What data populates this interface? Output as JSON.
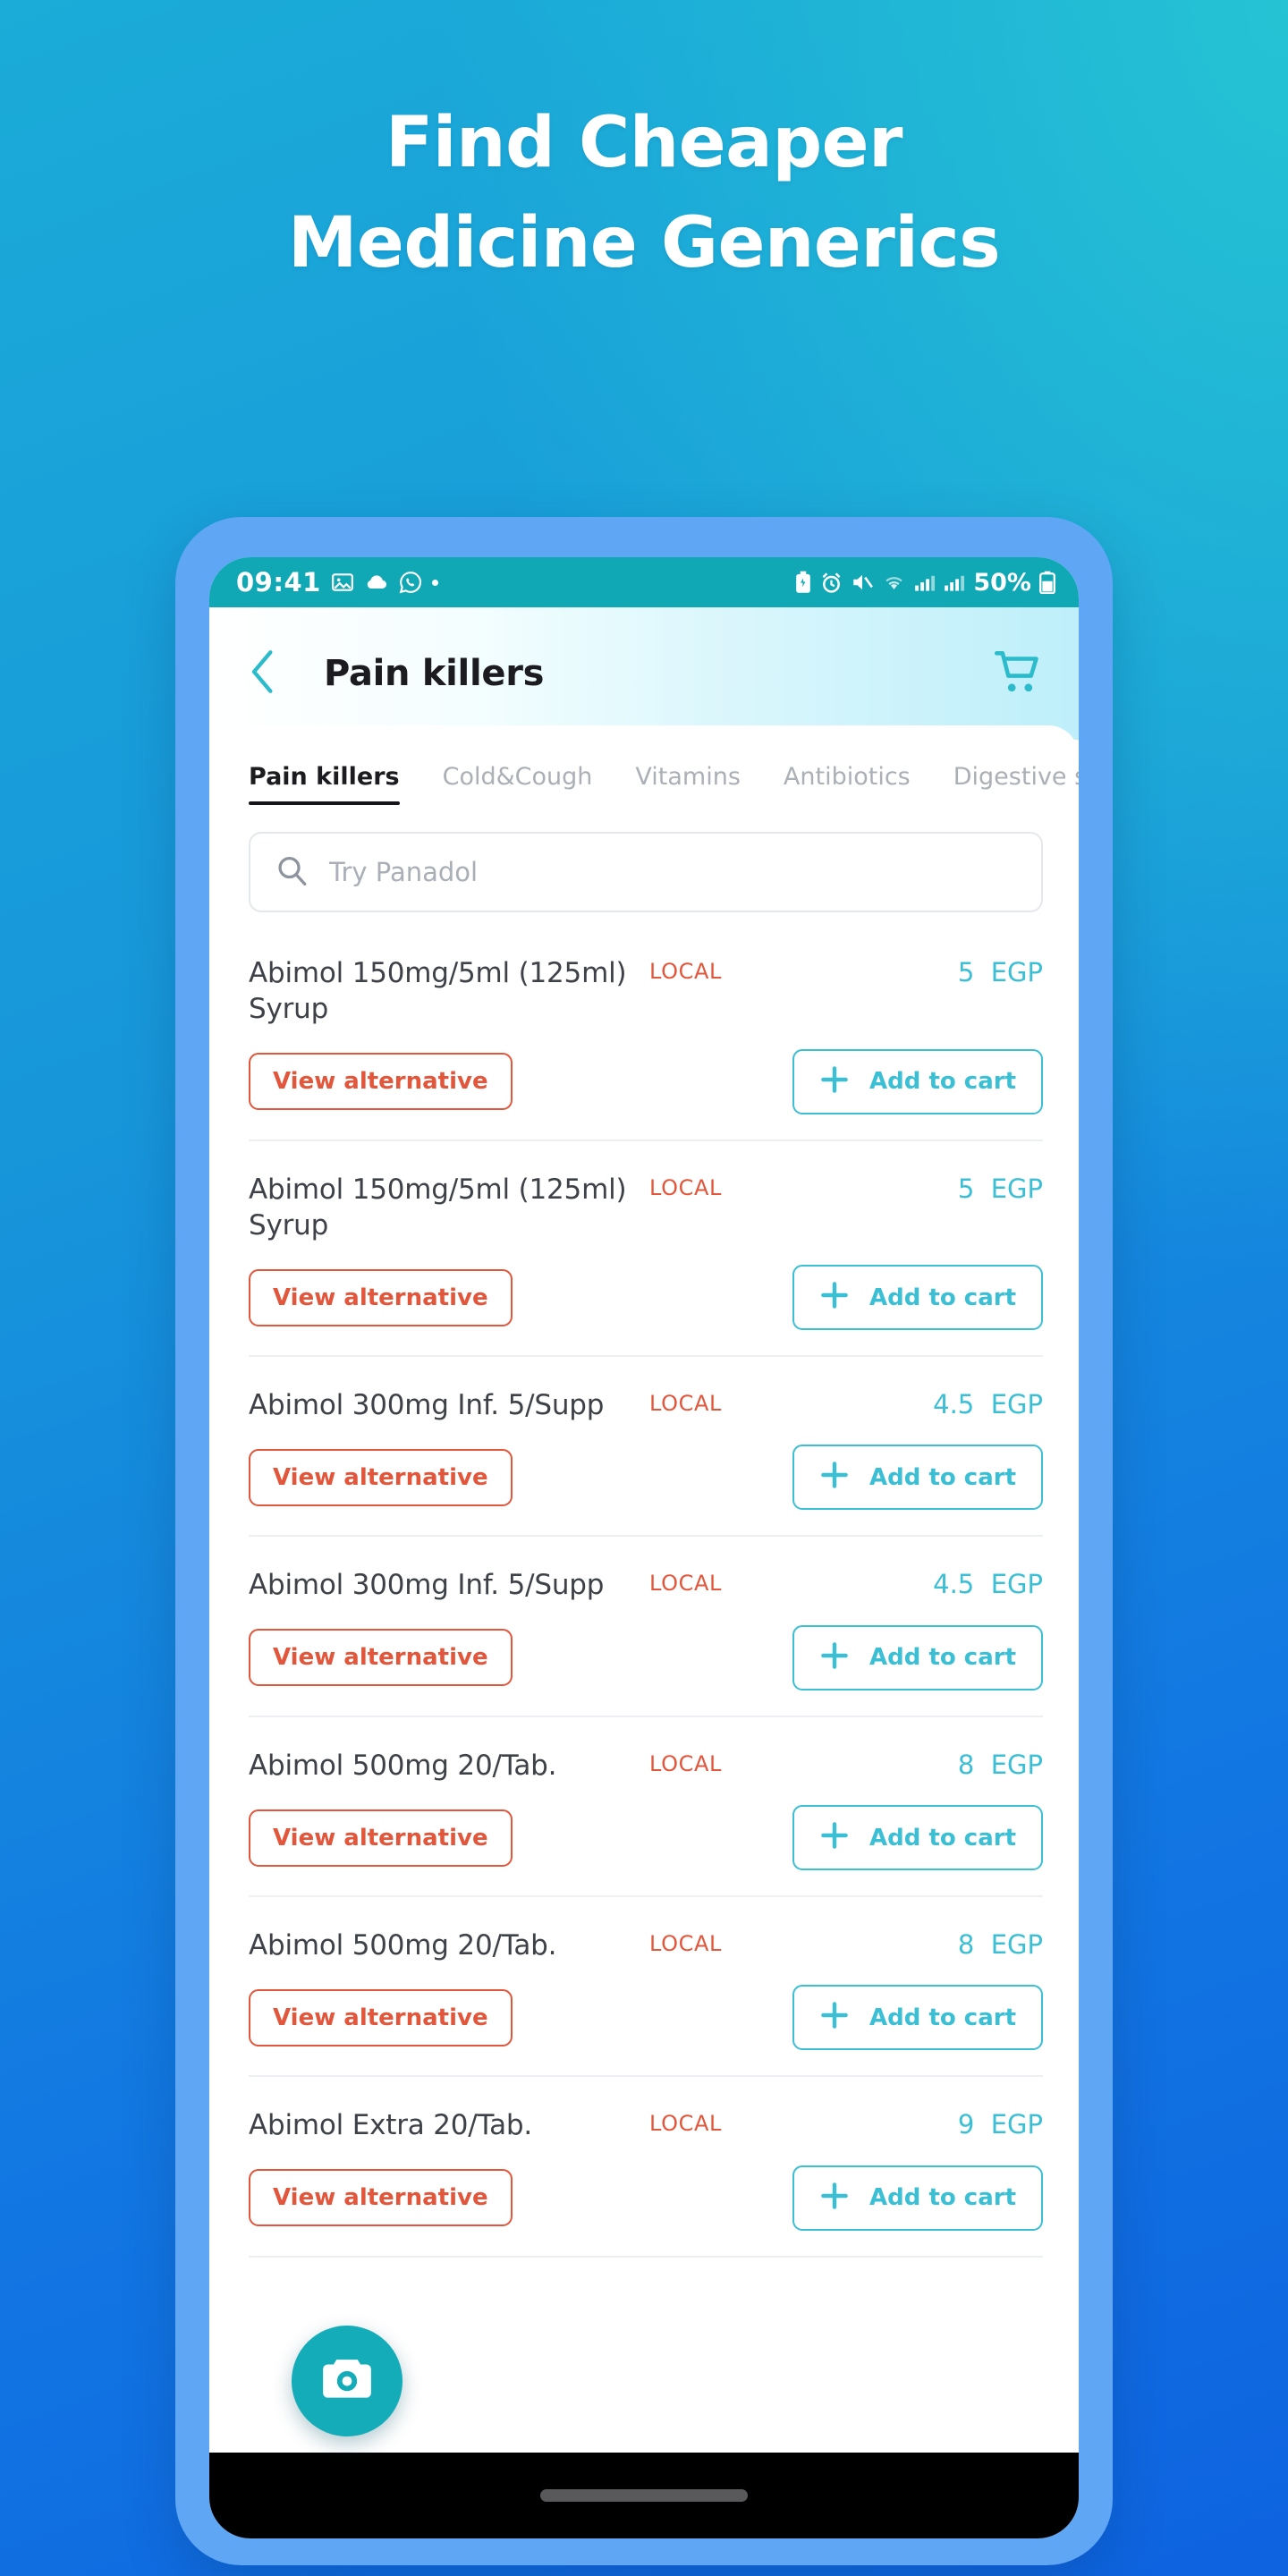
{
  "promo": {
    "line1": "Find Cheaper",
    "line2": "Medicine Generics"
  },
  "colors": {
    "background_start": "#25C3D4",
    "background_end": "#0E63E0",
    "phone_bezel": "#5FA6F5",
    "statusbar": "#0FA8B4",
    "accent_teal": "#3BBFD4",
    "accent_orange": "#E2563B",
    "fab": "#13ACB8",
    "tab_inactive": "#ABAFB6",
    "title": "#1C1C20"
  },
  "status_bar": {
    "time": "09:41",
    "battery_percent": "50%",
    "left_icons": [
      "photo-icon",
      "cloud-icon",
      "whatsapp-icon",
      "dot-icon"
    ],
    "right_icons": [
      "battery-saver-icon",
      "alarm-icon",
      "mute-icon",
      "wifi-icon",
      "signal-1-icon",
      "signal-2-icon"
    ]
  },
  "app_bar": {
    "back_label": "back-chevron-icon",
    "title": "Pain killers",
    "cart_label": "cart-icon"
  },
  "tabs": [
    {
      "label": "Pain killers",
      "active": true
    },
    {
      "label": "Cold&Cough",
      "active": false
    },
    {
      "label": "Vitamins",
      "active": false
    },
    {
      "label": "Antibiotics",
      "active": false
    },
    {
      "label": "Digestive system",
      "active": false
    }
  ],
  "search": {
    "placeholder": "Try Panadol",
    "value": "",
    "icon": "search-icon"
  },
  "actions": {
    "view_alternative": "View alternative",
    "add_to_cart": "Add to cart",
    "plus_icon": "plus-icon",
    "camera_fab": "camera-icon"
  },
  "products": [
    {
      "name": "Abimol 150mg/5ml (125ml) Syrup",
      "badge": "LOCAL",
      "price": "5",
      "currency": "EGP"
    },
    {
      "name": "Abimol 150mg/5ml (125ml) Syrup",
      "badge": "LOCAL",
      "price": "5",
      "currency": "EGP"
    },
    {
      "name": "Abimol 300mg Inf. 5/Supp",
      "badge": "LOCAL",
      "price": "4.5",
      "currency": "EGP"
    },
    {
      "name": "Abimol 300mg Inf. 5/Supp",
      "badge": "LOCAL",
      "price": "4.5",
      "currency": "EGP"
    },
    {
      "name": "Abimol 500mg 20/Tab.",
      "badge": "LOCAL",
      "price": "8",
      "currency": "EGP"
    },
    {
      "name": "Abimol 500mg 20/Tab.",
      "badge": "LOCAL",
      "price": "8",
      "currency": "EGP"
    },
    {
      "name": "Abimol Extra 20/Tab.",
      "badge": "LOCAL",
      "price": "9",
      "currency": "EGP"
    }
  ]
}
